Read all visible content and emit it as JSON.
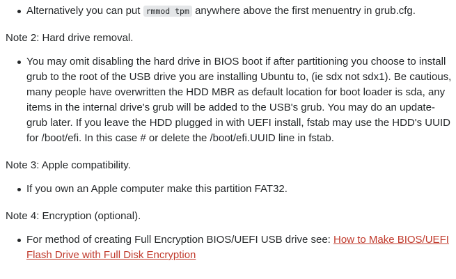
{
  "bullet_1": {
    "text_before": "Alternatively you can put ",
    "code": "rmmod tpm",
    "text_after": " anywhere above the first menuentry in grub.cfg."
  },
  "note_2": {
    "heading": "Note 2: Hard drive removal.",
    "bullet": "You may omit disabling the hard drive in BIOS boot if after partitioning you choose to install grub to the root of the USB drive you are installing Ubuntu to, (ie sdx not sdx1). Be cautious, many people have overwritten the HDD MBR as default location for boot loader is sda, any items in the internal drive's grub will be added to the USB's grub. You may do an update-grub later. If you leave the HDD plugged in with UEFI install, fstab may use the HDD's UUID for /boot/efi. In this case # or delete the /boot/efi.UUID line in fstab."
  },
  "note_3": {
    "heading": "Note 3: Apple compatibility.",
    "bullet": "If you own an Apple computer make this partition FAT32."
  },
  "note_4": {
    "heading": "Note 4: Encryption (optional).",
    "bullet_text": "For method of creating Full Encryption BIOS/UEFI USB drive see: ",
    "link_text": "How to Make BIOS/UEFI Flash Drive with Full Disk Encryption"
  },
  "colors": {
    "text": "#242729",
    "link": "#c0392b",
    "code_bg": "#e4e6e8"
  }
}
